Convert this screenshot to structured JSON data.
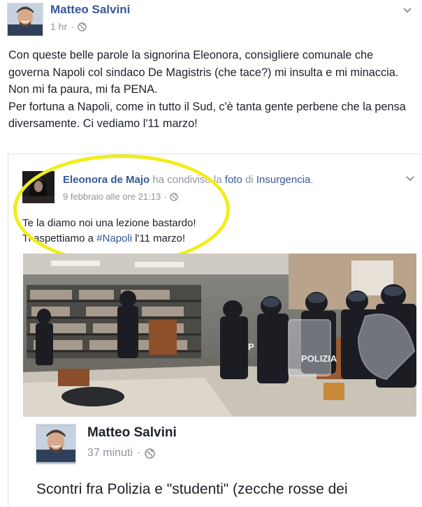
{
  "post": {
    "author": "Matteo Salvini",
    "time": "1 hr",
    "separator": "·",
    "text_lines": [
      "Con queste belle parole la signorina Eleonora, consigliere comunale che governa Napoli col sindaco De Magistris (che tace?) mi insulta e mi minaccia.",
      "Non mi fa paura, mi fa PENA.",
      "Per fortuna a Napoli, come in tutto il Sud, c'è tanta gente perbene che la pensa diversamente. Ci vediamo l'11 marzo!"
    ]
  },
  "shared": {
    "author": "Eleonora de Majo",
    "action_1": "ha condiviso la",
    "link_1": "foto",
    "action_2": "di",
    "link_2": "Insurgencia",
    "period": ".",
    "time": "9 febbraio alle ore 21:13",
    "separator": "·",
    "line_1": "Te la diamo noi una lezione bastardo!",
    "line_2_prefix": "Ti aspettiamo a ",
    "line_2_hashtag": "#Napoli",
    "line_2_suffix": " l'11 marzo!",
    "highlight_color": "#f0ee18"
  },
  "nested": {
    "author": "Matteo Salvini",
    "time": "37 minuti",
    "separator": "·",
    "text": "Scontri fra Polizia e \"studenti\" (zecche rosse dei"
  },
  "colors": {
    "link": "#365899",
    "meta": "#90949c",
    "text": "#1d2129",
    "border": "#dddfe2"
  },
  "icons": {
    "privacy": "globe-icon",
    "menu": "chevron-down-icon"
  }
}
